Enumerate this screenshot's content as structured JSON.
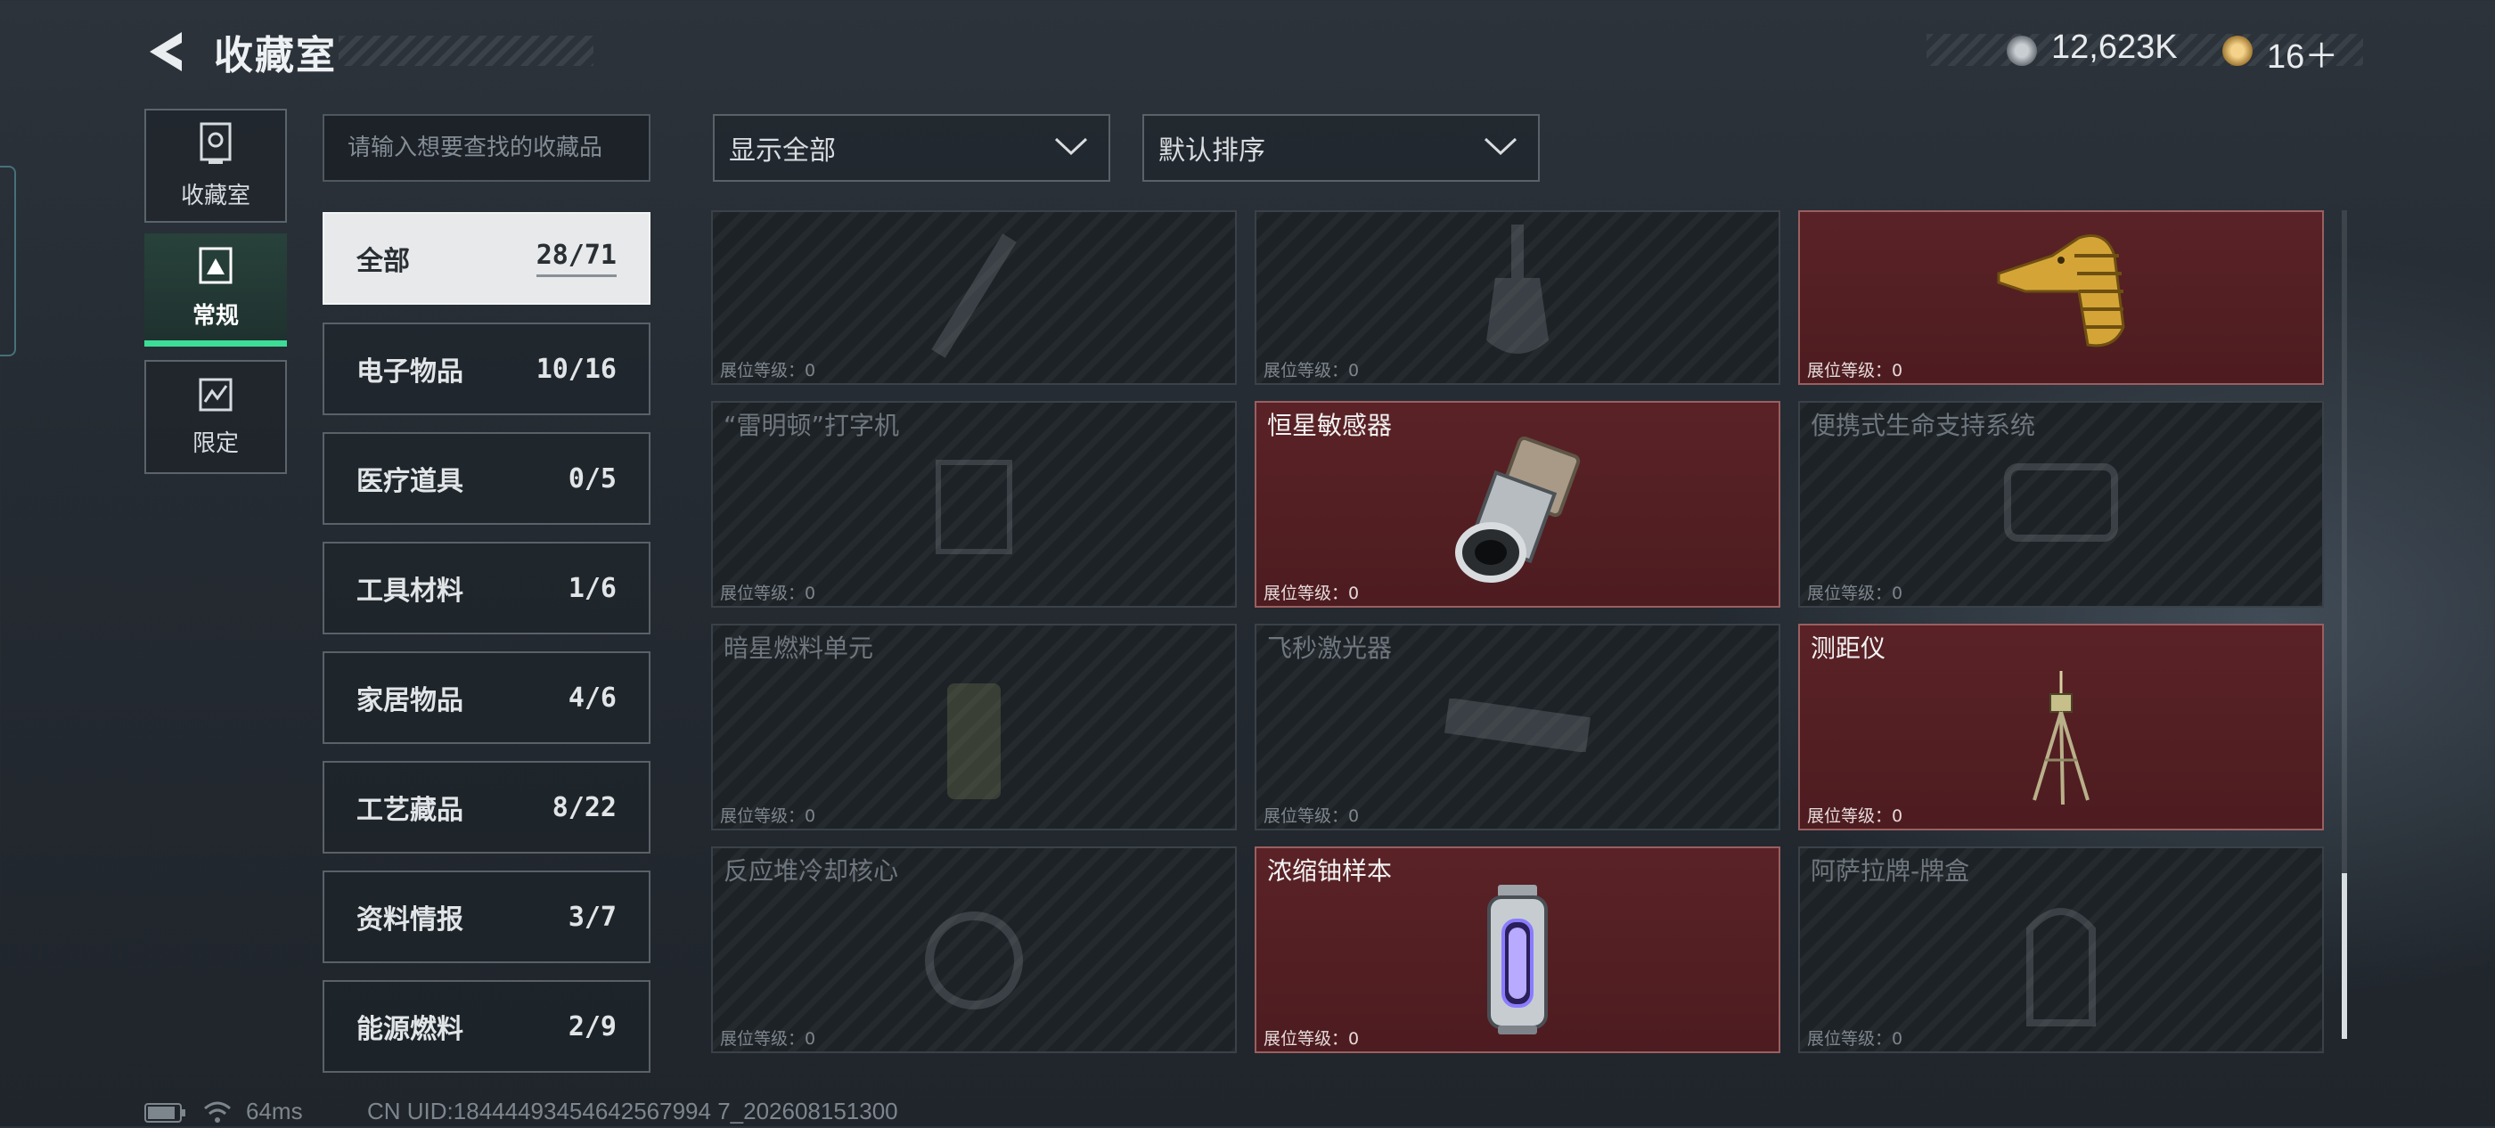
{
  "header": {
    "title": "收藏室",
    "currency1": "12,623K",
    "currency2": "16＋"
  },
  "nav": {
    "items": [
      {
        "label": "收藏室",
        "icon": "collection-room-icon"
      },
      {
        "label": "常规",
        "icon": "regular-icon"
      },
      {
        "label": "限定",
        "icon": "limited-icon"
      }
    ],
    "active": "常规"
  },
  "search": {
    "placeholder": "请输入想要查找的收藏品"
  },
  "categories": [
    {
      "name": "全部",
      "count": "28/71"
    },
    {
      "name": "电子物品",
      "count": "10/16"
    },
    {
      "name": "医疗道具",
      "count": "0/5"
    },
    {
      "name": "工具材料",
      "count": "1/6"
    },
    {
      "name": "家居物品",
      "count": "4/6"
    },
    {
      "name": "工艺藏品",
      "count": "8/22"
    },
    {
      "name": "资料情报",
      "count": "3/7"
    },
    {
      "name": "能源燃料",
      "count": "2/9"
    }
  ],
  "filters": {
    "display": "显示全部",
    "sort": "默认排序"
  },
  "items": [
    {
      "name": "",
      "level": "展位等级：0",
      "owned": false
    },
    {
      "name": "",
      "level": "展位等级：0",
      "owned": false
    },
    {
      "name": "",
      "level": "展位等级：0",
      "owned": true
    },
    {
      "name": "“雷明顿”打字机",
      "level": "展位等级：0",
      "owned": false
    },
    {
      "name": "恒星敏感器",
      "level": "展位等级：0",
      "owned": true
    },
    {
      "name": "便携式生命支持系统",
      "level": "展位等级：0",
      "owned": false
    },
    {
      "name": "暗星燃料单元",
      "level": "展位等级：0",
      "owned": false
    },
    {
      "name": "飞秒激光器",
      "level": "展位等级：0",
      "owned": false
    },
    {
      "name": "测距仪",
      "level": "展位等级：0",
      "owned": true
    },
    {
      "name": "反应堆冷却核心",
      "level": "展位等级：0",
      "owned": false
    },
    {
      "name": "浓缩铀样本",
      "level": "展位等级：0",
      "owned": true
    },
    {
      "name": "阿萨拉牌-牌盒",
      "level": "展位等级：0",
      "owned": false
    }
  ],
  "footer": {
    "ping": "64ms",
    "uid": "CN UID:18444493454642567994 7_202608151300"
  },
  "colors": {
    "accent_green": "#3ddc97",
    "owned_card": "#5a2226",
    "active_category": "#e7e9eb"
  }
}
